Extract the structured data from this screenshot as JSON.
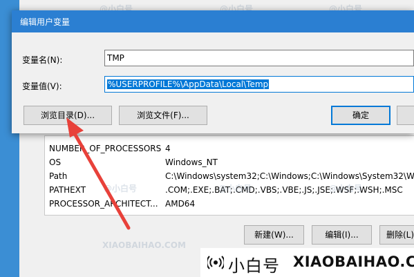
{
  "dialog": {
    "title": "编辑用户变量",
    "name_label": "变量名(N):",
    "name_value": "TMP",
    "value_label": "变量值(V):",
    "value_value": "%USERPROFILE%\\AppData\\Local\\Temp",
    "browse_dir_label": "浏览目录(D)...",
    "browse_file_label": "浏览文件(F)...",
    "ok_label": "确定"
  },
  "system_vars": {
    "rows": [
      {
        "name": "NUMBER_OF_PROCESSORS",
        "value": "4"
      },
      {
        "name": "OS",
        "value": "Windows_NT"
      },
      {
        "name": "Path",
        "value": "C:\\Windows\\system32;C:\\Windows;C:\\Windows\\System32\\Wb..."
      },
      {
        "name": "PATHEXT",
        "value": ".COM;.EXE;.BAT;.CMD;.VBS;.VBE;.JS;.JSE;.WSF;.WSH;.MSC"
      },
      {
        "name": "PROCESSOR_ARCHITECT...",
        "value": "AMD64"
      }
    ],
    "new_label": "新建(W)...",
    "edit_label": "编辑(I)...",
    "delete_label": "删除(L)"
  },
  "brand": {
    "name_cn": "小白号",
    "name_en": "XIAOBAIHAO.COM"
  },
  "watermark": {
    "cn": "@小白号",
    "en": "XIAOBAIHAO.COM"
  },
  "colors": {
    "title_bar": "#2b7fd2",
    "selection": "#0078d7",
    "arrow": "#e8413a"
  }
}
